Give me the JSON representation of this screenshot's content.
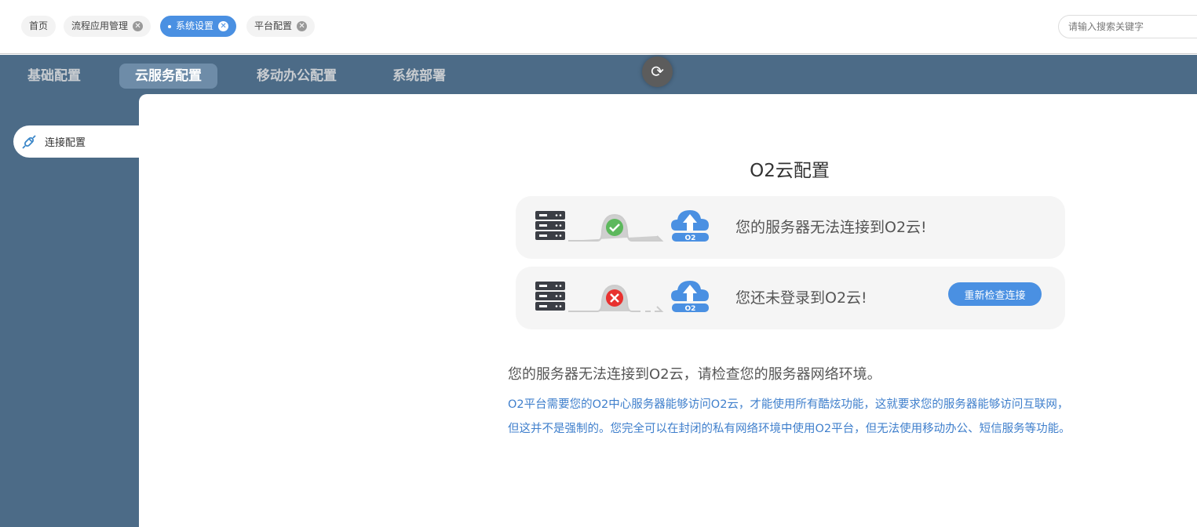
{
  "tabs": [
    {
      "label": "首页",
      "closable": false,
      "active": false
    },
    {
      "label": "流程应用管理",
      "closable": true,
      "active": false
    },
    {
      "label": "系统设置",
      "closable": true,
      "active": true
    },
    {
      "label": "平台配置",
      "closable": true,
      "active": false
    }
  ],
  "search": {
    "placeholder": "请输入搜索关键字"
  },
  "menu": [
    {
      "label": "基础配置"
    },
    {
      "label": "云服务配置",
      "active": true
    },
    {
      "label": "移动办公配置"
    },
    {
      "label": "系统部署"
    }
  ],
  "refresh_icon": "refresh-icon",
  "sidebar": {
    "items": [
      {
        "label": "连接配置",
        "icon": "plug-icon"
      }
    ]
  },
  "main": {
    "title": "O2云配置",
    "status": [
      {
        "text": "您的服务器无法连接到O2云!",
        "state": "ok",
        "cloud_label": "O2"
      },
      {
        "text": "您还未登录到O2云!",
        "state": "error",
        "cloud_label": "O2",
        "button": "重新检查连接"
      }
    ],
    "heading": "您的服务器无法连接到O2云，请检查您的服务器网络环境。",
    "description": "O2平台需要您的O2中心服务器能够访问O2云，才能使用所有酷炫功能，这就要求您的服务器能够访问互联网，但这并不是强制的。您完全可以在封闭的私有网络环境中使用O2平台，但无法使用移动办公、短信服务等功能。"
  },
  "colors": {
    "accent": "#4a90e2",
    "nav": "#4c6b87",
    "ok": "#5cb85c",
    "error": "#e8312f"
  }
}
